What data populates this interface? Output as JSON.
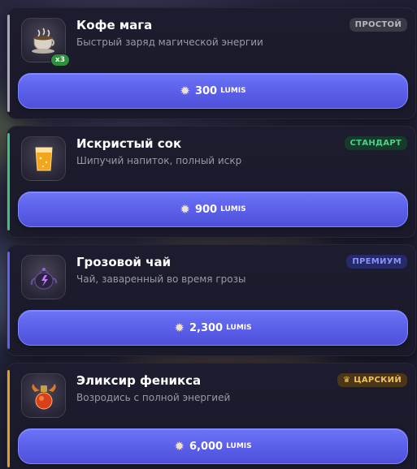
{
  "colors": {
    "accent_basic": "#a9a7b8",
    "accent_standard": "#3ec276",
    "accent_premium": "#5b61f0",
    "accent_royal": "#e0a020",
    "buy_button": "#5a5ee8"
  },
  "items": [
    {
      "title": "Кофе мага",
      "description": "Быстрый заряд магической энергии",
      "tier": "ПРОСТОЙ",
      "quantity_badge": "x3",
      "icon": "coffee-cup-icon",
      "price": "300",
      "currency": "LUMIS"
    },
    {
      "title": "Искристый сок",
      "description": "Шипучий напиток, полный искр",
      "tier": "СТАНДАРТ",
      "icon": "juice-glass-icon",
      "price": "900",
      "currency": "LUMIS"
    },
    {
      "title": "Грозовой чай",
      "description": "Чай, заваренный во время грозы",
      "tier": "ПРЕМИУМ",
      "icon": "storm-teapot-icon",
      "price": "2,300",
      "currency": "LUMIS"
    },
    {
      "title": "Эликсир феникса",
      "description": "Возродись с полной энергией",
      "tier": "ЦАРСКИЙ",
      "tier_icon": "crown-icon",
      "icon": "phoenix-potion-icon",
      "price": "6,000",
      "currency": "LUMIS"
    }
  ]
}
